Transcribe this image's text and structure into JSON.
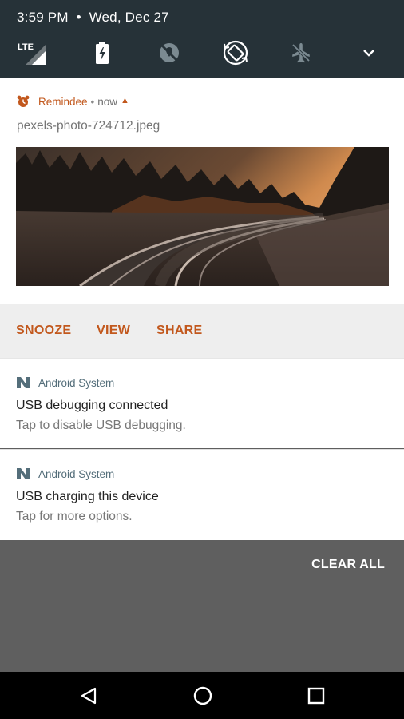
{
  "status_bar": {
    "time": "3:59 PM",
    "date": "Wed, Dec 27",
    "network_label": "LTE"
  },
  "quick_settings": {
    "tiles": [
      "signal-lte-icon",
      "battery-charging-icon",
      "location-off-icon",
      "auto-rotate-icon",
      "airplane-mode-icon",
      "expand-chevron-icon"
    ]
  },
  "notifications": [
    {
      "app": "Remindee",
      "when": "now",
      "content": "pexels-photo-724712.jpeg",
      "actions": [
        "SNOOZE",
        "VIEW",
        "SHARE"
      ]
    },
    {
      "app": "Android System",
      "title": "USB debugging connected",
      "text": "Tap to disable USB debugging."
    },
    {
      "app": "Android System",
      "title": "USB charging this device",
      "text": "Tap for more options."
    }
  ],
  "clear_all": "CLEAR ALL",
  "colors": {
    "accent": "#c2581d",
    "header_bg": "#263238",
    "shade_bg": "#5f5f5f",
    "system_app": "#546e7a"
  }
}
